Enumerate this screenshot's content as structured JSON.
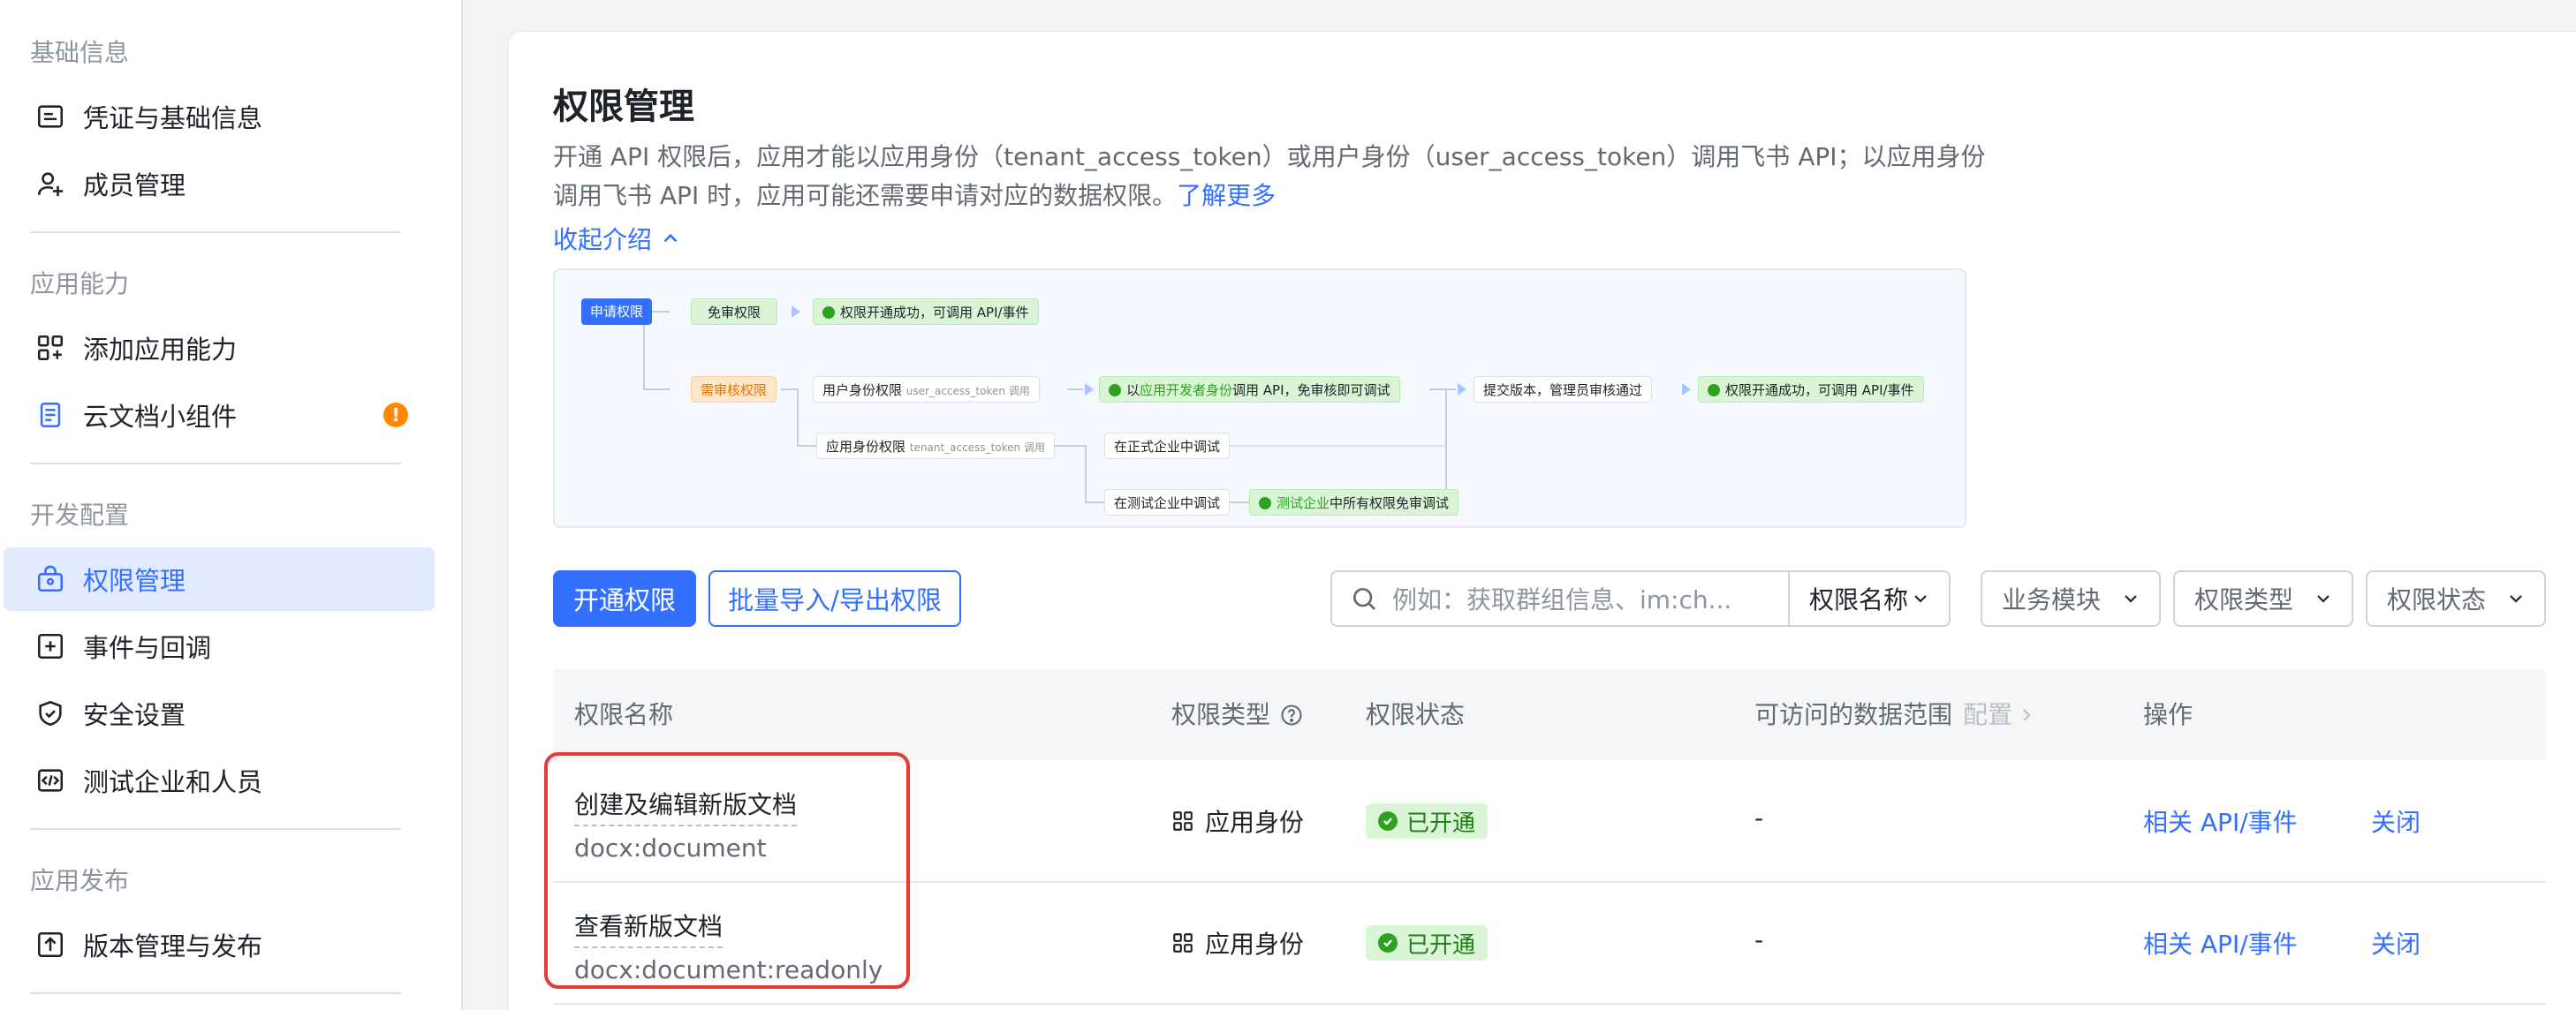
{
  "sidebar": {
    "groups": [
      {
        "title": "基础信息",
        "items": [
          {
            "label": "凭证与基础信息",
            "icon": "id-card-icon"
          },
          {
            "label": "成员管理",
            "icon": "user-add-icon"
          }
        ]
      },
      {
        "title": "应用能力",
        "items": [
          {
            "label": "添加应用能力",
            "icon": "app-add-icon"
          },
          {
            "label": "云文档小组件",
            "icon": "doc-widget-icon",
            "badge": "!"
          }
        ]
      },
      {
        "title": "开发配置",
        "items": [
          {
            "label": "权限管理",
            "icon": "permission-icon",
            "active": true
          },
          {
            "label": "事件与回调",
            "icon": "event-icon"
          },
          {
            "label": "安全设置",
            "icon": "shield-icon"
          },
          {
            "label": "测试企业和人员",
            "icon": "code-icon"
          }
        ]
      },
      {
        "title": "应用发布",
        "items": [
          {
            "label": "版本管理与发布",
            "icon": "upload-icon"
          }
        ]
      }
    ]
  },
  "main": {
    "title": "权限管理",
    "desc_text": "开通 API 权限后，应用才能以应用身份（tenant_access_token）或用户身份（user_access_token）调用飞书 API；以应用身份调用飞书 API 时，应用可能还需要申请对应的数据权限。",
    "learn_more": "了解更多",
    "collapse_label": "收起介绍",
    "flow": {
      "apply": "申请权限",
      "exempt": "免审权限",
      "success1": "权限开通成功，可调用 API/事件",
      "need_review": "需审核权限",
      "user_identity": "用户身份权限",
      "user_token": "user_access_token 调用",
      "dev_debug_pre": "以",
      "dev_debug_hl": "应用开发者身份",
      "dev_debug_post": "调用 API，免审核即可调试",
      "submit": "提交版本，管理员审核通过",
      "success2": "权限开通成功，可调用 API/事件",
      "app_identity": "应用身份权限",
      "tenant_token": "tenant_access_token 调用",
      "prod_debug": "在正式企业中调试",
      "test_debug": "在测试企业中调试",
      "test_ent_hl": "测试企业",
      "test_ent_post": "中所有权限免审调试"
    },
    "toolbar": {
      "enable_button": "开通权限",
      "import_button": "批量导入/导出权限",
      "search_placeholder": "例如：获取群组信息、im:ch...",
      "filters": [
        "权限名称",
        "业务模块",
        "权限类型",
        "权限状态"
      ]
    },
    "table": {
      "headers": {
        "name": "权限名称",
        "type": "权限类型",
        "status": "权限状态",
        "scope": "可访问的数据范围",
        "scope_config": "配置",
        "actions": "操作"
      },
      "rows": [
        {
          "name": "创建及编辑新版文档",
          "code": "docx:document",
          "type": "应用身份",
          "status": "已开通",
          "scope": "-",
          "action_api": "相关 API/事件",
          "action_close": "关闭"
        },
        {
          "name": "查看新版文档",
          "code": "docx:document:readonly",
          "type": "应用身份",
          "status": "已开通",
          "scope": "-",
          "action_api": "相关 API/事件",
          "action_close": "关闭"
        }
      ]
    }
  },
  "colors": {
    "accent": "#3370ff",
    "success": "#2ea121",
    "badge": "#ff8800",
    "highlight": "#e53935"
  }
}
